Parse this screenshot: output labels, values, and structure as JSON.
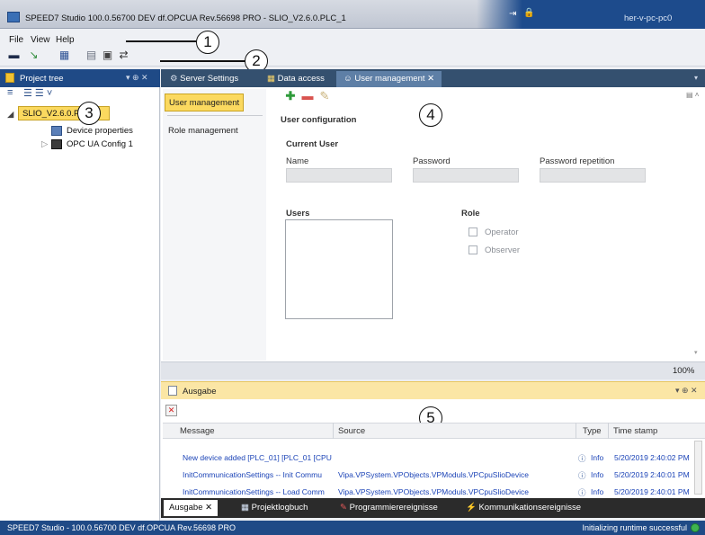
{
  "window": {
    "title": "SPEED7 Studio 100.0.56700 DEV df.OPCUA Rev.56698 PRO - SLIO_V2.6.0.PLC_1",
    "user": "her-v-pc-pc0"
  },
  "menu": [
    "File",
    "View",
    "Help"
  ],
  "project_tree": {
    "title": "Project tree",
    "pin": "▾ ⊕ ✕",
    "items": [
      {
        "label": "SLIO_V2.6.0.PLC_1",
        "level": 0
      },
      {
        "label": "Device properties",
        "level": 1
      },
      {
        "label": "OPC UA Config 1",
        "level": 1
      }
    ]
  },
  "tabs": [
    {
      "label": "Server Settings",
      "active": false
    },
    {
      "label": "Data access",
      "active": false
    },
    {
      "label": "User management",
      "active": true,
      "closable": true
    }
  ],
  "subnav": [
    "User management",
    "Role management"
  ],
  "user_config": {
    "heading": "User configuration",
    "current_user": "Current User",
    "name_label": "Name",
    "password_label": "Password",
    "password_repeat_label": "Password repetition",
    "users_label": "Users",
    "role_label": "Role",
    "roles": [
      "Operator",
      "Observer"
    ]
  },
  "zoom": "100%",
  "output": {
    "title": "Ausgabe",
    "columns": [
      "Message",
      "Source",
      "Type",
      "Time stamp"
    ],
    "rows": [
      {
        "message": "New device added [PLC_01] [PLC_01 [CPU",
        "source": "",
        "type": "Info",
        "time": "5/20/2019 2:40:02 PM"
      },
      {
        "message": "InitCommunicationSettings -- Init Commu",
        "source": "Vipa.VPSystem.VPObjects.VPModuls.VPCpuSlioDevice",
        "type": "Info",
        "time": "5/20/2019 2:40:01 PM"
      },
      {
        "message": "InitCommunicationSettings -- Load Comm",
        "source": "Vipa.VPSystem.VPObjects.VPModuls.VPCpuSlioDevice",
        "type": "Info",
        "time": "5/20/2019 2:40:01 PM"
      }
    ]
  },
  "bottom_tabs": [
    {
      "label": "Ausgabe",
      "active": true
    },
    {
      "label": "Projektlogbuch",
      "active": false
    },
    {
      "label": "Programmierereignisse",
      "active": false
    },
    {
      "label": "Kommunikationsereignisse",
      "active": false
    }
  ],
  "status": {
    "left": "SPEED7 Studio - 100.0.56700 DEV df.OPCUA Rev.56698 PRO",
    "right": "Initializing runtime successful"
  },
  "callouts": [
    "1",
    "2",
    "3",
    "4",
    "5"
  ],
  "colors": {
    "accent_blue": "#1f4a86",
    "selection_yellow": "#fbd95f",
    "output_header": "#fbe6a5",
    "status_ok": "#3fb34f"
  }
}
